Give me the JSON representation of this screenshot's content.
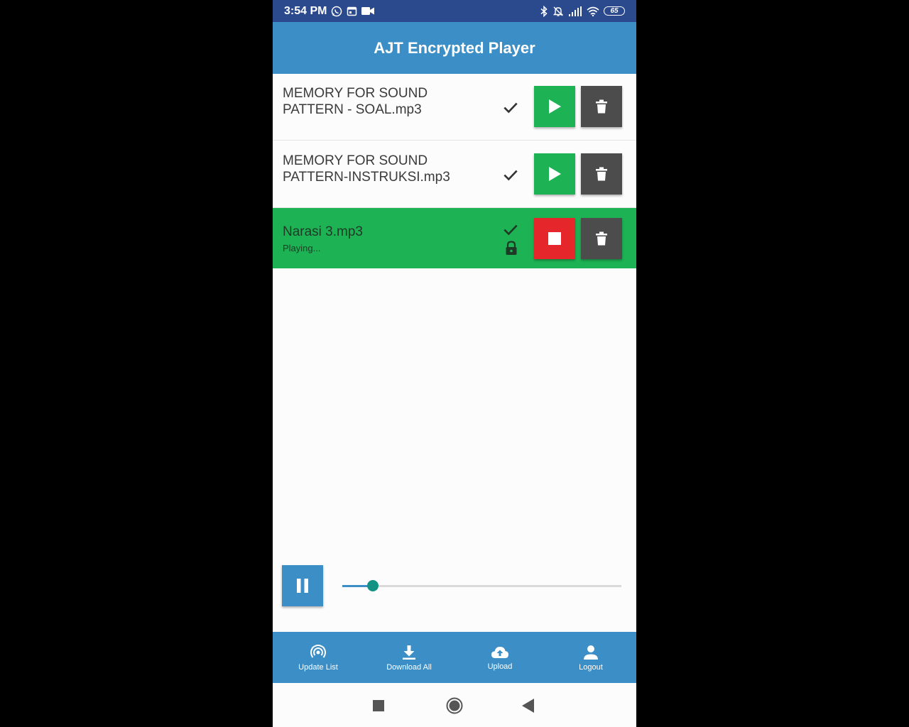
{
  "status_bar": {
    "time": "3:54 PM",
    "battery": "65",
    "left_icons": [
      "whatsapp-icon",
      "calendar-icon",
      "video-camera-icon"
    ],
    "right_icons": [
      "bluetooth-icon",
      "mute-icon",
      "signal-icon",
      "wifi-icon",
      "battery-icon"
    ]
  },
  "app_bar": {
    "title": "AJT Encrypted Player"
  },
  "tracks": [
    {
      "title": "MEMORY FOR SOUND PATTERN - SOAL.mp3",
      "status": "",
      "downloaded": true,
      "locked": false,
      "playing": false
    },
    {
      "title": "MEMORY FOR SOUND PATTERN-INSTRUKSI.mp3",
      "status": "",
      "downloaded": true,
      "locked": false,
      "playing": false
    },
    {
      "title": "Narasi 3.mp3",
      "status": "Playing...",
      "downloaded": true,
      "locked": true,
      "playing": true
    }
  ],
  "player": {
    "progress_percent": 11
  },
  "bottom_nav": [
    {
      "label": "Update List",
      "icon": "broadcast-icon"
    },
    {
      "label": "Download All",
      "icon": "download-icon"
    },
    {
      "label": "Upload",
      "icon": "cloud-upload-icon"
    },
    {
      "label": "Logout",
      "icon": "person-icon"
    }
  ],
  "system_nav": [
    "recents-button",
    "home-button",
    "back-button"
  ],
  "colors": {
    "status_bar": "#2b4a8e",
    "primary": "#3b8ec6",
    "play_green": "#1db354",
    "stop_red": "#e5262a",
    "delete_gray": "#4c4c4c",
    "slider_thumb": "#129384"
  }
}
